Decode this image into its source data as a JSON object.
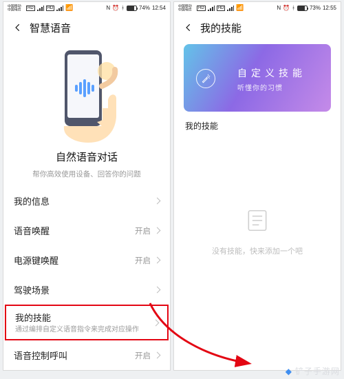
{
  "left": {
    "status": {
      "carrier1": "中国移动",
      "carrier2": "中国电信",
      "wifi_icon": "📶",
      "nfc": "N",
      "alarm": "⏰",
      "bt": "ᚼ",
      "battery": "74%",
      "time": "12:54"
    },
    "title": "智慧语音",
    "headline": "自然语音对话",
    "subline": "帮你高效使用设备、回答你的问题",
    "rows": {
      "my_info": "我的信息",
      "wake": "语音唤醒",
      "wake_val": "开启",
      "power_wake": "电源键唤醒",
      "power_wake_val": "开启",
      "drive": "驾驶场景",
      "my_skill": "我的技能",
      "my_skill_sub": "通过编排自定义语音指令来完成对应操作",
      "voice_call": "语音控制呼叫",
      "voice_call_val": "开启"
    }
  },
  "right": {
    "status": {
      "carrier1": "中国移动",
      "carrier2": "中国电信",
      "wifi_icon": "📶",
      "nfc": "N",
      "alarm": "⏰",
      "bt": "ᚼ",
      "battery": "73%",
      "time": "12:55"
    },
    "title": "我的技能",
    "banner_title": "自定义技能",
    "banner_sub": "听懂你的习惯",
    "section": "我的技能",
    "empty": "没有技能，快来添加一个吧"
  },
  "watermark": "铲子手游网"
}
